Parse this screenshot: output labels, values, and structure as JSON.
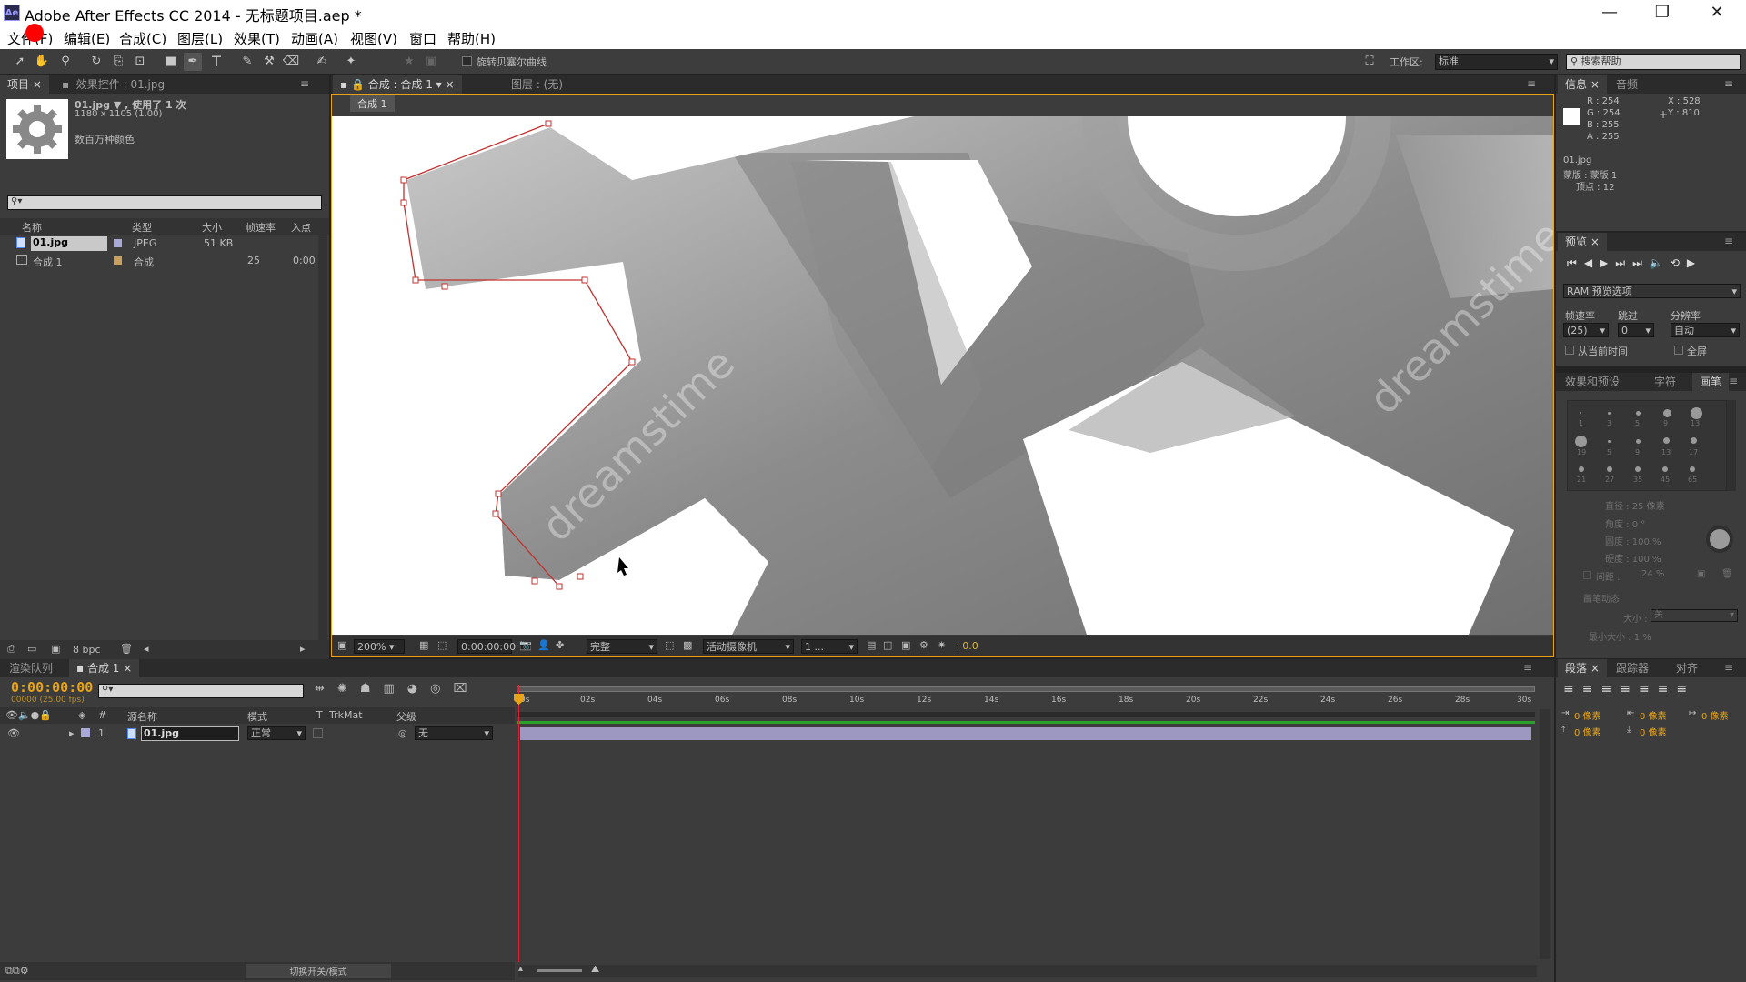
{
  "window": {
    "title": "Adobe After Effects CC 2014 - 无标题项目.aep *",
    "app_icon": "Ae"
  },
  "menu": [
    "文件(F)",
    "编辑(E)",
    "合成(C)",
    "图层(L)",
    "效果(T)",
    "动画(A)",
    "视图(V)",
    "窗口",
    "帮助(H)"
  ],
  "toolbar": {
    "rotobezier_label": "旋转贝塞尔曲线",
    "workspace_label": "工作区:",
    "workspace_value": "标准",
    "search_placeholder": "搜索帮助"
  },
  "project": {
    "tab_project": "项目",
    "tab_effects": "效果控件 : 01.jpg",
    "thumb_name": "01.jpg ▼ , 使用了 1 次",
    "thumb_size": "1180 x 1105 (1.00)",
    "thumb_colors": "数百万种颜色",
    "columns": [
      "名称",
      "类型",
      "大小",
      "帧速率",
      "入点"
    ],
    "items": [
      {
        "name": "01.jpg",
        "type": "JPEG",
        "size": "51 KB",
        "fps": "",
        "in": ""
      },
      {
        "name": "合成 1",
        "type": "合成",
        "size": "",
        "fps": "25",
        "in": "0:00"
      }
    ],
    "bpc": "8 bpc"
  },
  "comp": {
    "tab_comp": "合成 : 合成 1",
    "tab_layer": "图层 : (无)",
    "breadcrumb": "合成 1",
    "zoom": "200%",
    "time": "0:00:00:00",
    "resolution": "完整",
    "camera": "活动摄像机",
    "views": "1 ...",
    "exposure": "+0.0",
    "watermark": "dreamstime"
  },
  "info": {
    "tab_info": "信息",
    "tab_audio": "音频",
    "r": "R : 254",
    "g": "G : 254",
    "b": "B : 255",
    "a": "A : 255",
    "x": "X : 528",
    "y": "Y : 810",
    "file": "01.jpg",
    "mask": "蒙版 : 蒙版 1",
    "vertex": "顶点 : 12"
  },
  "preview": {
    "tab": "预览",
    "ram": "RAM 预览选项",
    "fps_label": "帧速率",
    "skip_label": "跳过",
    "res_label": "分辨率",
    "fps_value": "(25)",
    "skip_value": "0",
    "res_value": "自动",
    "from_current": "从当前时间",
    "fullscreen": "全屏"
  },
  "brush": {
    "tab_effects": "效果和预设",
    "tab_char": "字符",
    "tab_brush": "画笔",
    "sizes": [
      "1",
      "3",
      "5",
      "9",
      "13",
      "19",
      "5",
      "9",
      "13",
      "17",
      "21",
      "27",
      "35",
      "45",
      "65"
    ],
    "diameter": "直径 : 25 像素",
    "angle": "角度 : 0 °",
    "roundness": "圆度 : 100 %",
    "hardness": "硬度 : 100 %",
    "spacing": "间距 :",
    "spacing_val": "24 %",
    "dynamics": "画笔动态",
    "size_label": "大小 :",
    "size_val": "关",
    "min_size": "最小大小 : 1 %"
  },
  "paragraph": {
    "tab": "段落",
    "tab_tracker": "跟踪器",
    "tab_align": "对齐",
    "px": "0 像素"
  },
  "timeline": {
    "tab_render": "渲染队列",
    "tab_comp": "合成 1",
    "timecode": "0:00:00:00",
    "frames": "00000 (25.00 fps)",
    "col_source": "源名称",
    "col_mode": "模式",
    "col_t": "T",
    "col_trkmat": "TrkMat",
    "col_parent": "父级",
    "layer_index": "1",
    "layer_name": "01.jpg",
    "layer_mode": "正常",
    "layer_parent": "无",
    "ticks": [
      "0s",
      "02s",
      "04s",
      "06s",
      "08s",
      "10s",
      "12s",
      "14s",
      "16s",
      "18s",
      "20s",
      "22s",
      "24s",
      "26s",
      "28s",
      "30s"
    ],
    "toggle": "切换开关/模式"
  },
  "colors": {
    "accent": "#e8a317",
    "mask": "#c0312f",
    "layer_bar": "#9d98c1",
    "work_area": "#2aa12a"
  }
}
